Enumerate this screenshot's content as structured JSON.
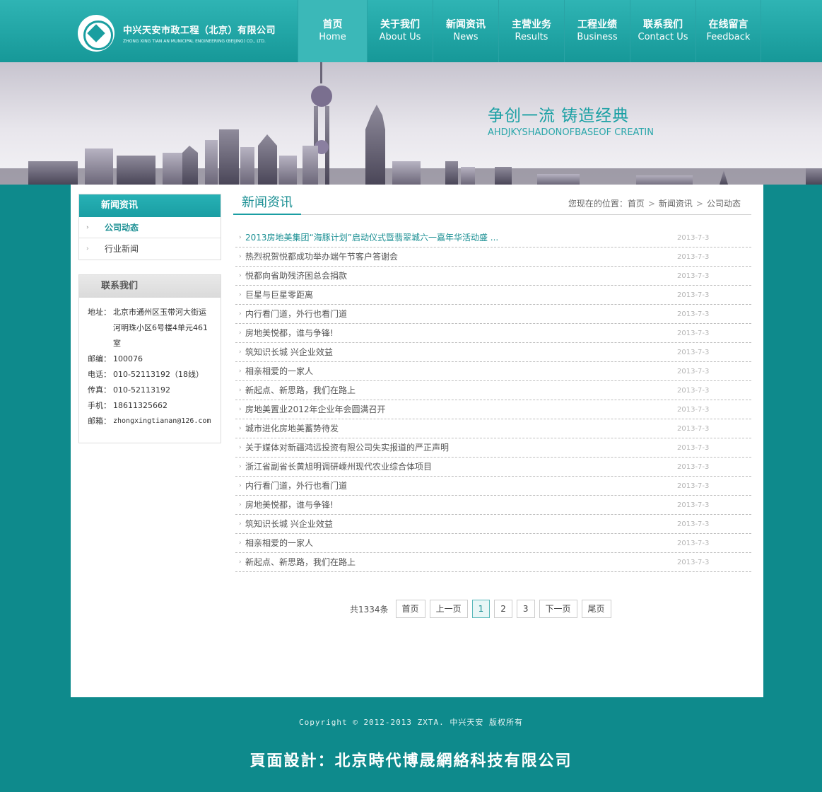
{
  "header": {
    "company_cn": "中兴天安市政工程（北京）有限公司",
    "company_en": "ZHONG XING TIAN AN MUNICIPAL ENGINEERING (BEIJING) CO., LTD.",
    "nav": [
      {
        "cn": "首页",
        "en": "Home"
      },
      {
        "cn": "关于我们",
        "en": "About Us"
      },
      {
        "cn": "新闻资讯",
        "en": "News"
      },
      {
        "cn": "主营业务",
        "en": "Results"
      },
      {
        "cn": "工程业绩",
        "en": "Business"
      },
      {
        "cn": "联系我们",
        "en": "Contact Us"
      },
      {
        "cn": "在线留言",
        "en": "Feedback"
      }
    ]
  },
  "banner": {
    "slogan_cn": "争创一流  铸造经典",
    "slogan_en": "AHDJKYSHADONOFBASEOF CREATIN"
  },
  "sidebar": {
    "news_title": "新闻资讯",
    "news_items": [
      "公司动态",
      "行业新闻"
    ],
    "contact_title": "联系我们",
    "contact": {
      "address_label": "地址：",
      "address": "北京市通州区玉带河大街运河明珠小区6号楼4单元461室",
      "zip_label": "邮编：",
      "zip": "100076",
      "phone_label": "电话：",
      "phone": "010-52113192（18线）",
      "fax_label": "传真：",
      "fax": "010-52113192",
      "mobile_label": "手机：",
      "mobile": "18611325662",
      "email_label": "邮箱：",
      "email": "zhongxingtianan@126.com"
    }
  },
  "content": {
    "title": "新闻资讯",
    "breadcrumb_prefix": "您现在的位置：",
    "breadcrumb": [
      "首页",
      "新闻资讯",
      "公司动态"
    ],
    "news": [
      {
        "title": "2013房地美集团“海豚计划”启动仪式暨翡翠城六一嘉年华活动盛 ...",
        "date": "2013-7-3"
      },
      {
        "title": "热烈祝贺悦都成功举办端午节客户答谢会",
        "date": "2013-7-3"
      },
      {
        "title": "悦都向省助残济困总会捐款",
        "date": "2013-7-3"
      },
      {
        "title": "巨星与巨星零距离",
        "date": "2013-7-3"
      },
      {
        "title": "内行看门道，外行也看门道",
        "date": "2013-7-3"
      },
      {
        "title": "房地美悦都，谁与争锋!",
        "date": "2013-7-3"
      },
      {
        "title": "筑知识长城 兴企业效益",
        "date": "2013-7-3"
      },
      {
        "title": "相亲相爱的一家人",
        "date": "2013-7-3"
      },
      {
        "title": "新起点、新思路，我们在路上",
        "date": "2013-7-3"
      },
      {
        "title": "房地美置业2012年企业年会圆满召开",
        "date": "2013-7-3"
      },
      {
        "title": "城市进化房地美蓄势待发",
        "date": "2013-7-3"
      },
      {
        "title": "关于媒体对新疆鸿远投资有限公司失实报道的严正声明",
        "date": "2013-7-3"
      },
      {
        "title": "浙江省副省长黄旭明调研嵊州现代农业综合体项目",
        "date": "2013-7-3"
      },
      {
        "title": "内行看门道，外行也看门道",
        "date": "2013-7-3"
      },
      {
        "title": "房地美悦都，谁与争锋!",
        "date": "2013-7-3"
      },
      {
        "title": "筑知识长城 兴企业效益",
        "date": "2013-7-3"
      },
      {
        "title": "相亲相爱的一家人",
        "date": "2013-7-3"
      },
      {
        "title": "新起点、新思路，我们在路上",
        "date": "2013-7-3"
      }
    ],
    "pager": {
      "total": "共1334条",
      "first": "首页",
      "prev": "上一页",
      "pages": [
        "1",
        "2",
        "3"
      ],
      "current": "1",
      "next": "下一页",
      "last": "尾页"
    }
  },
  "footer": {
    "copyright": "Copyright © 2012-2013 ZXTA. 中兴天安 版权所有",
    "designer": "頁面設計：北京時代博晟網絡科技有限公司"
  },
  "colors": {
    "teal": "#1a9ea3",
    "background": "#0e8a8c",
    "header": "#169898"
  }
}
